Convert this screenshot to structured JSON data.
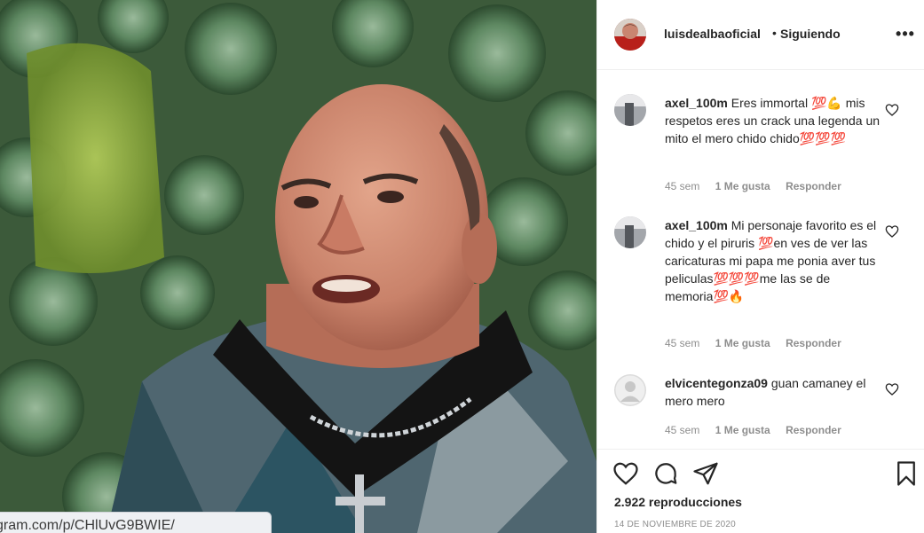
{
  "post": {
    "username": "luisdealbaoficial",
    "separator": "•",
    "follow_status": "Siguiendo",
    "more_label": "•••"
  },
  "media": {
    "url_text": "gram.com/p/CHlUvG9BWIE/"
  },
  "comments": [
    {
      "username": "axel_100m",
      "text": "Eres immortal 💯💪 mis respetos eres un crack una legenda un mito el mero chido chido💯💯💯",
      "age": "45 sem",
      "likes": "1 Me gusta",
      "reply": "Responder"
    },
    {
      "username": "axel_100m",
      "text": "Mi personaje favorito es el chido y el piruris 💯en ves de ver las caricaturas mi papa me ponia aver tus peliculas💯💯💯me las se de memoria💯🔥",
      "age": "45 sem",
      "likes": "1 Me gusta",
      "reply": "Responder"
    },
    {
      "username": "elvicentegonza09",
      "text": "guan camaney el mero mero",
      "age": "45 sem",
      "likes": "1 Me gusta",
      "reply": "Responder"
    }
  ],
  "stats": {
    "views": "2.922 reproducciones",
    "date": "14 DE NOVIEMBRE DE 2020"
  },
  "icons": {
    "like": "heart-icon",
    "comment": "comment-icon",
    "share": "share-icon",
    "save": "bookmark-icon",
    "more": "more-icon"
  },
  "colors": {
    "text": "#262626",
    "secondary": "#8e8e8e",
    "border": "#efefef"
  }
}
